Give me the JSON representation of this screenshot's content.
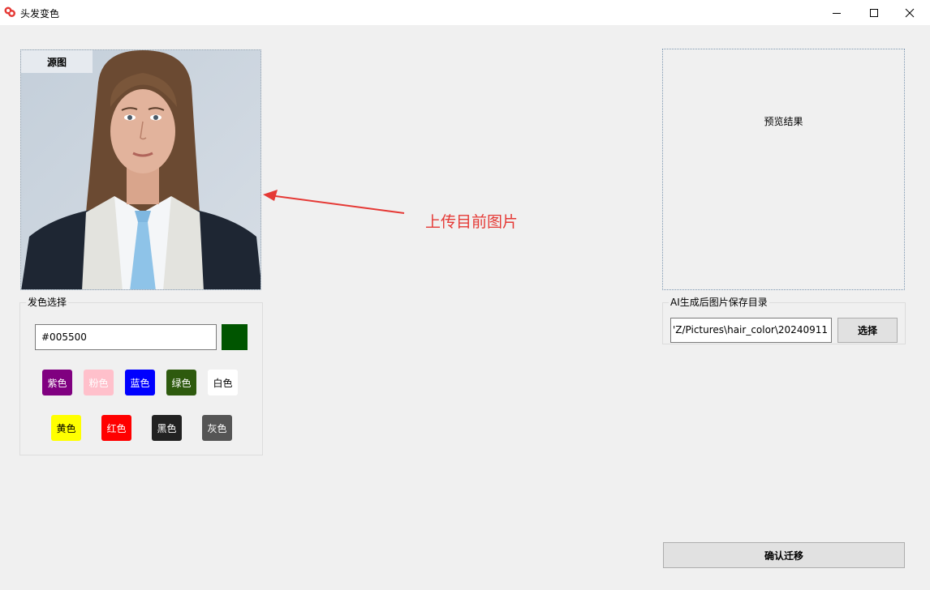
{
  "window": {
    "title": "头发变色"
  },
  "source_panel": {
    "tab_label": "源图"
  },
  "annotation": {
    "text": "上传目前图片",
    "color": "#e53935"
  },
  "hair_color": {
    "group_title": "发色选择",
    "hex_value": "#005500",
    "selected_color": "#005500",
    "presets": [
      {
        "label": "紫色",
        "bg": "#800080",
        "fg": "#ffffff"
      },
      {
        "label": "粉色",
        "bg": "#ffc0cb",
        "fg": "#ffffff"
      },
      {
        "label": "蓝色",
        "bg": "#0000ff",
        "fg": "#ffffff"
      },
      {
        "label": "绿色",
        "bg": "#2e5a0e",
        "fg": "#ffffff"
      },
      {
        "label": "白色",
        "bg": "#ffffff",
        "fg": "#000000"
      },
      {
        "label": "黄色",
        "bg": "#ffff00",
        "fg": "#000000"
      },
      {
        "label": "红色",
        "bg": "#ff0000",
        "fg": "#ffffff"
      },
      {
        "label": "黑色",
        "bg": "#222222",
        "fg": "#ffffff"
      },
      {
        "label": "灰色",
        "bg": "#555555",
        "fg": "#ffffff"
      }
    ]
  },
  "preview": {
    "label": "预览结果"
  },
  "save_dir": {
    "group_title": "AI生成后图片保存目录",
    "path_value": "'Z/Pictures\\hair_color\\20240911",
    "choose_label": "选择"
  },
  "confirm": {
    "label": "确认迁移"
  },
  "icons": {
    "app": "app-logo-icon",
    "minimize": "minimize-icon",
    "maximize": "maximize-icon",
    "close": "close-icon"
  }
}
